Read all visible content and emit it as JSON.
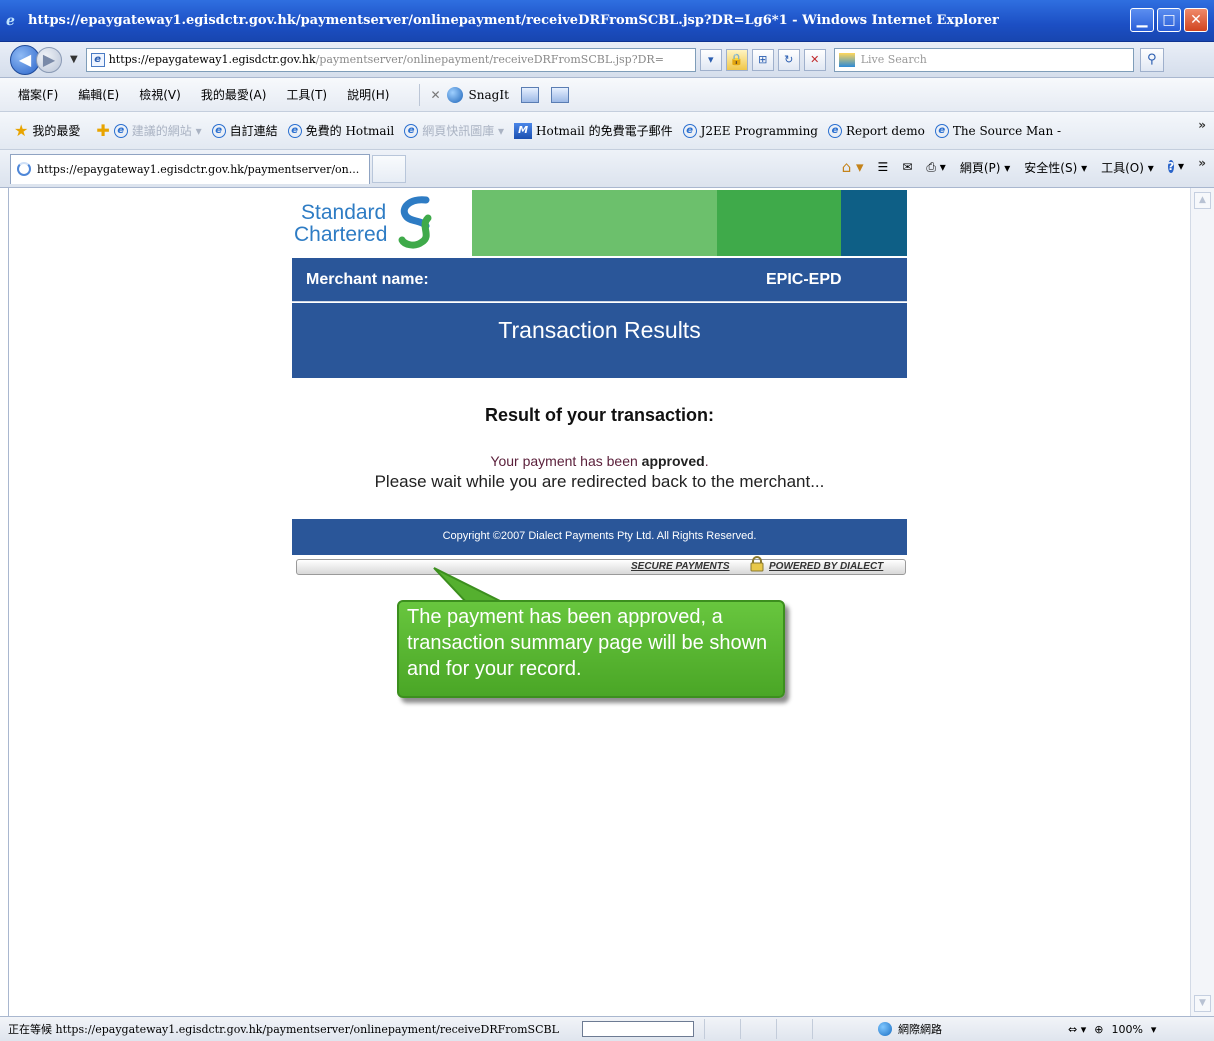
{
  "window": {
    "title": "https://epaygateway1.egisdctr.gov.hk/paymentserver/onlinepayment/receiveDRFromSCBL.jsp?DR=Lg6*1 - Windows Internet Explorer"
  },
  "address_bar": {
    "url_host": "https://epaygateway1.egisdctr.gov.hk",
    "url_rest": "/paymentserver/onlinepayment/receiveDRFromSCBL.jsp?DR=",
    "search_placeholder": "Live Search"
  },
  "menu": {
    "items": [
      "檔案(F)",
      "編輯(E)",
      "檢視(V)",
      "我的最愛(A)",
      "工具(T)",
      "說明(H)"
    ],
    "snagit_label": "SnagIt"
  },
  "favorites": {
    "label": "我的最愛",
    "items": [
      "建議的網站",
      "自訂連結",
      "免費的 Hotmail",
      "網頁快訊圖庫",
      "Hotmail 的免費電子郵件",
      "J2EE Programming",
      "Report demo",
      "The Source Man -"
    ]
  },
  "tab": {
    "title": "https://epaygateway1.egisdctr.gov.hk/paymentserver/on..."
  },
  "commandbar": {
    "page_label": "網頁(P)",
    "safety_label": "安全性(S)",
    "tools_label": "工具(O)"
  },
  "page": {
    "logo_line1": "Standard",
    "logo_line2": "Chartered",
    "merchant_label": "Merchant name:",
    "merchant_value": "EPIC-EPD",
    "results_title": "Transaction Results",
    "result_heading": "Result of your transaction:",
    "approved_prefix": "Your payment has been ",
    "approved_word": "approved",
    "approved_suffix": ".",
    "wait_message": "Please wait while you are redirected back to the merchant...",
    "copyright": "Copyright ©2007 Dialect Payments Pty Ltd. All Rights Reserved.",
    "secure_payments": "SECURE PAYMENTS",
    "powered_by": "POWERED BY DIALECT"
  },
  "callout": {
    "text": "The payment has been approved, a transaction summary page will be shown and for your record."
  },
  "status": {
    "text": "正在等候 https://epaygateway1.egisdctr.gov.hk/paymentserver/onlinepayment/receiveDRFromSCBL",
    "zone": "網際網路",
    "zoom": "100%"
  },
  "colors": {
    "sc_blue": "#2a5699",
    "sc_green_light": "#6cc06c",
    "sc_green": "#3faa4a",
    "sc_teal": "#0e5f86",
    "callout_green": "#4aa626"
  }
}
